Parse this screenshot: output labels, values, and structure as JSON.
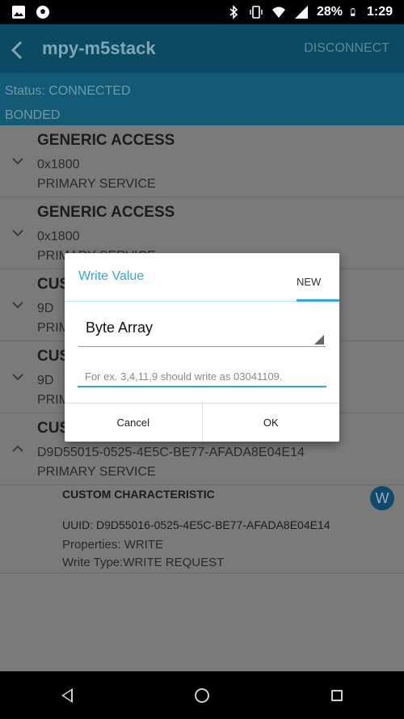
{
  "status_bar": {
    "battery": "28%",
    "time": "1:29",
    "icons": [
      "image-icon",
      "soccer-ball-icon",
      "bluetooth-icon",
      "vibrate-icon",
      "wifi-icon",
      "signal-icon",
      "battery-icon"
    ]
  },
  "appbar": {
    "title": "mpy-m5stack",
    "disconnect_label": "DISCONNECT"
  },
  "connection": {
    "status": "Status: CONNECTED",
    "bond": "BONDED"
  },
  "services": [
    {
      "name": "GENERIC ACCESS",
      "uuid": "0x1800",
      "type": "PRIMARY SERVICE"
    },
    {
      "name": "GENERIC ACCESS",
      "uuid": "0x1800",
      "type": "PRIMARY SERVICE"
    },
    {
      "name": "CUS",
      "uuid": "9D",
      "type": "PRIM"
    },
    {
      "name": "CUS",
      "uuid": "9D",
      "type": "PRIM"
    },
    {
      "name": "CUS",
      "uuid": "D9D55015-0525-4E5C-BE77-AFADA8E04E14",
      "type": "PRIMARY SERVICE"
    }
  ],
  "characteristic": {
    "title": "CUSTOM CHARACTERISTIC",
    "uuid": "UUID: D9D55016-0525-4E5C-BE77-AFADA8E04E14",
    "properties": "Properties: WRITE",
    "write_type": "Write Type:WRITE REQUEST",
    "write_button": "W"
  },
  "dialog": {
    "title": "Write Value",
    "tab_new": "NEW",
    "format_value": "Byte Array",
    "input_placeholder": "For ex. 3,4,11,9 should write as 03041109.",
    "cancel_label": "Cancel",
    "ok_label": "OK"
  }
}
